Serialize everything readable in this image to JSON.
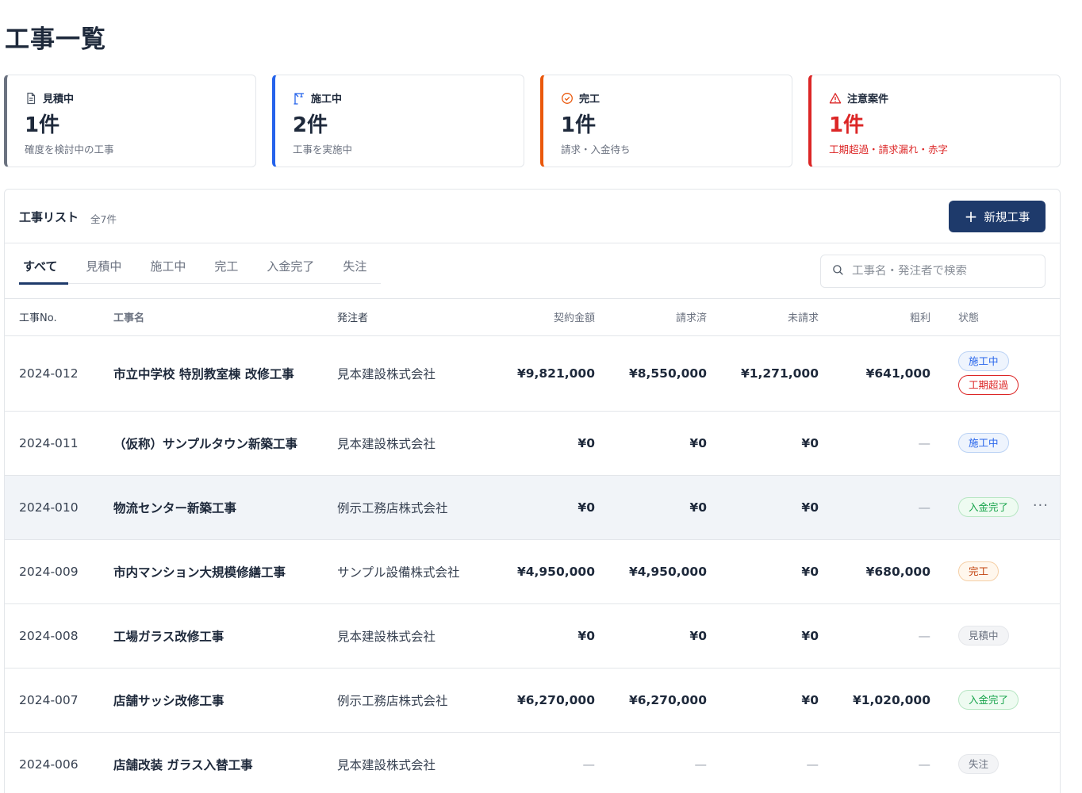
{
  "page": {
    "title": "工事一覧"
  },
  "cards": [
    {
      "label": "見積中",
      "count": "1件",
      "desc": "確度を検討中の工事",
      "icon": "document-icon"
    },
    {
      "label": "施工中",
      "count": "2件",
      "desc": "工事を実施中",
      "icon": "crane-icon"
    },
    {
      "label": "完工",
      "count": "1件",
      "desc": "請求・入金待ち",
      "icon": "check-circle-icon"
    },
    {
      "label": "注意案件",
      "count": "1件",
      "desc": "工期超過・請求漏れ・赤字",
      "icon": "warning-icon"
    }
  ],
  "list": {
    "title": "工事リスト",
    "count": "全7件",
    "new_button": "新規工事",
    "search_placeholder": "工事名・発注者で検索",
    "tabs": [
      "すべて",
      "見積中",
      "施工中",
      "完工",
      "入金完了",
      "失注"
    ],
    "active_tab": "すべて",
    "columns": [
      "工事No.",
      "工事名",
      "発注者",
      "契約金額",
      "請求済",
      "未請求",
      "粗利",
      "状態"
    ],
    "rows": [
      {
        "no": "2024-012",
        "name": "市立中学校 特別教室棟 改修工事",
        "client": "見本建設株式会社",
        "contract": "¥9,821,000",
        "billed": "¥8,550,000",
        "unbilled": "¥1,271,000",
        "profit": "¥641,000",
        "status": [
          "施工中",
          "工期超過"
        ]
      },
      {
        "no": "2024-011",
        "name": "（仮称）サンプルタウン新築工事",
        "client": "見本建設株式会社",
        "contract": "¥0",
        "billed": "¥0",
        "unbilled": "¥0",
        "profit": "—",
        "status": [
          "施工中"
        ]
      },
      {
        "no": "2024-010",
        "name": "物流センター新築工事",
        "client": "例示工務店株式会社",
        "contract": "¥0",
        "billed": "¥0",
        "unbilled": "¥0",
        "profit": "—",
        "status": [
          "入金完了"
        ],
        "more": "···"
      },
      {
        "no": "2024-009",
        "name": "市内マンション大規模修繕工事",
        "client": "サンプル設備株式会社",
        "contract": "¥4,950,000",
        "billed": "¥4,950,000",
        "unbilled": "¥0",
        "profit": "¥680,000",
        "status": [
          "完工"
        ]
      },
      {
        "no": "2024-008",
        "name": "工場ガラス改修工事",
        "client": "見本建設株式会社",
        "contract": "¥0",
        "billed": "¥0",
        "unbilled": "¥0",
        "profit": "—",
        "status": [
          "見積中"
        ]
      },
      {
        "no": "2024-007",
        "name": "店舗サッシ改修工事",
        "client": "例示工務店株式会社",
        "contract": "¥6,270,000",
        "billed": "¥6,270,000",
        "unbilled": "¥0",
        "profit": "¥1,020,000",
        "status": [
          "入金完了"
        ]
      },
      {
        "no": "2024-006",
        "name": "店舗改装 ガラス入替工事",
        "client": "見本建設株式会社",
        "contract": "—",
        "billed": "—",
        "unbilled": "—",
        "profit": "—",
        "status": [
          "失注"
        ]
      }
    ]
  },
  "colors": {
    "primary": "#1e3a6b",
    "estimate": "#6b7280",
    "in_progress": "#2563eb",
    "completed": "#ea580c",
    "alert": "#dc2626",
    "paid": "#16a34a"
  }
}
